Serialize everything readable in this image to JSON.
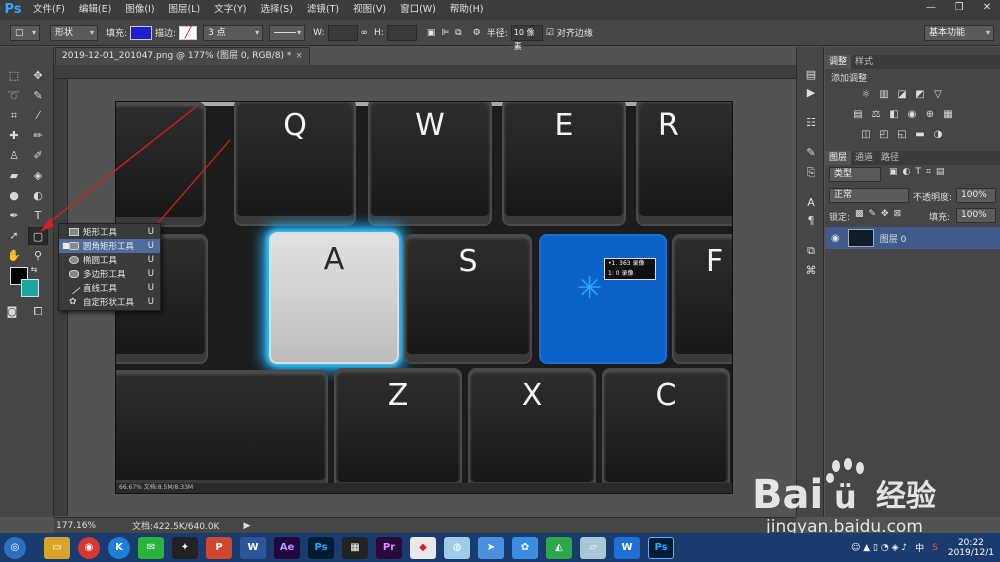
{
  "app": {
    "logo": "Ps"
  },
  "menu": [
    "文件(F)",
    "编辑(E)",
    "图像(I)",
    "图层(L)",
    "文字(Y)",
    "选择(S)",
    "滤镜(T)",
    "视图(V)",
    "窗口(W)",
    "帮助(H)"
  ],
  "options": {
    "mode": "形状",
    "fill_label": "填充:",
    "stroke_label": "描边:",
    "stroke_size": "3 点",
    "w_label": "W:",
    "h_label": "H:",
    "radius_label": "半径:",
    "radius_value": "10 像素",
    "align_label": "对齐边缘",
    "workspace": "基本功能"
  },
  "document": {
    "tab_title": "2019-12-01_201047.png @ 177% (图层 0, RGB/8) *",
    "close": "×"
  },
  "canvas": {
    "keys": [
      "Q",
      "W",
      "E",
      "R",
      "A",
      "S",
      "F",
      "Z",
      "X",
      "C"
    ],
    "blue_box_line1": "•1. 363 录像",
    "blue_box_line2": "1: 0 录像",
    "bottom_strip": "66.67%   文档:8.5M/8.33M"
  },
  "popup": {
    "items": [
      {
        "label": "矩形工具",
        "key": "U"
      },
      {
        "label": "圆角矩形工具",
        "key": "U"
      },
      {
        "label": "椭圆工具",
        "key": "U"
      },
      {
        "label": "多边形工具",
        "key": "U"
      },
      {
        "label": "直线工具",
        "key": "U"
      },
      {
        "label": "自定形状工具",
        "key": "U"
      }
    ],
    "active_index": 1
  },
  "status": {
    "zoom": "177.16%",
    "doc": "文档:422.5K/640.0K"
  },
  "panels": {
    "adjust_tabs": [
      "调整",
      "样式"
    ],
    "adjust_title": "添加调整",
    "layer_tabs": [
      "图层",
      "通道",
      "路径"
    ],
    "kind": "类型",
    "blend": "正常",
    "opacity_label": "不透明度:",
    "opacity": "100%",
    "lock_label": "锁定:",
    "fill_label": "填充:",
    "fill": "100%",
    "layer_name": "图层 0"
  },
  "taskbar": {
    "apps": [
      "Ae",
      "Ps",
      "Pr",
      "W",
      "P"
    ],
    "time": "20:22",
    "date": "2019/12/1",
    "ime": "中"
  },
  "watermark": {
    "brand": "Bai",
    "brand2": "经验",
    "url": "jingyan.baidu.com"
  },
  "colors": {
    "accent": "#20b8ff",
    "blue_key": "#0b62c8",
    "fill_swatch": "#1f1fcf",
    "bg_swatch": "#1aa7a0"
  }
}
